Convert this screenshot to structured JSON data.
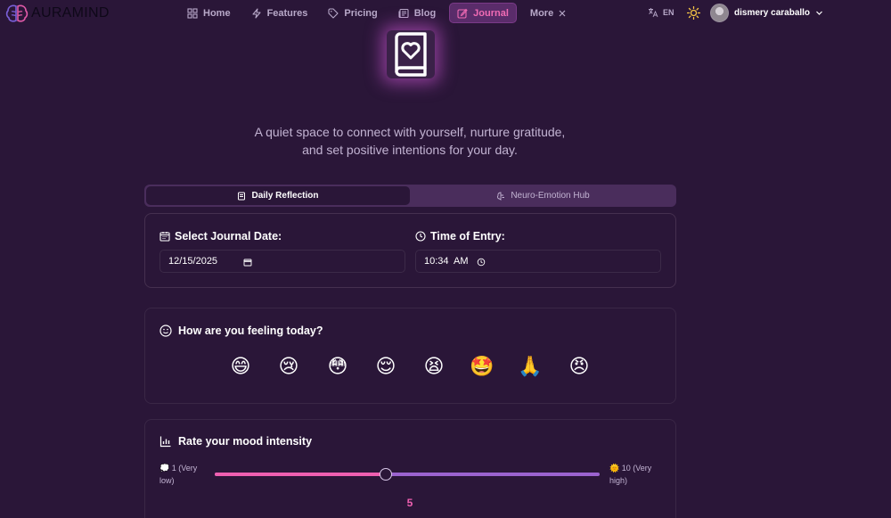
{
  "brand": {
    "name": "AURAMIND"
  },
  "nav": {
    "items": [
      {
        "label": "Home",
        "icon": "home-icon"
      },
      {
        "label": "Features",
        "icon": "zap-icon"
      },
      {
        "label": "Pricing",
        "icon": "tag-icon"
      },
      {
        "label": "Blog",
        "icon": "newspaper-icon"
      },
      {
        "label": "Journal",
        "icon": "pen-square-icon",
        "active": true
      },
      {
        "label": "More",
        "icon": "close-icon"
      }
    ]
  },
  "header": {
    "language": "EN",
    "user_name": "dismery caraballo"
  },
  "hero": {
    "tagline_line1": "A quiet space to connect with yourself, nurture gratitude,",
    "tagline_line2": "and set positive intentions for your day."
  },
  "tabs": {
    "daily_reflection": "Daily Reflection",
    "neuro_emotion_hub": "Neuro-Emotion Hub"
  },
  "entry": {
    "date_label": "Select Journal Date:",
    "date_value": "12/15/2025",
    "time_label": "Time of Entry:",
    "time_value": "10:34  AM"
  },
  "feelings": {
    "title": "How are you feeling today?",
    "emojis": [
      "😄",
      "😢",
      "😳",
      "😌",
      "😫",
      "🤩",
      "🙏",
      "😠"
    ]
  },
  "mood": {
    "title": "Rate your mood intensity",
    "min_label_line1": "💭 1 (Very",
    "min_label_line2": "low)",
    "max_label_line1": "🌞 10 (Very",
    "max_label_line2": "high)",
    "value": "5",
    "value_fraction": 0.4444
  },
  "colors": {
    "background": "#2a1638",
    "accent_pink": "#ee5fb0",
    "accent_purple": "#9b63cf",
    "active_nav_bg": "#5a2c6a"
  }
}
